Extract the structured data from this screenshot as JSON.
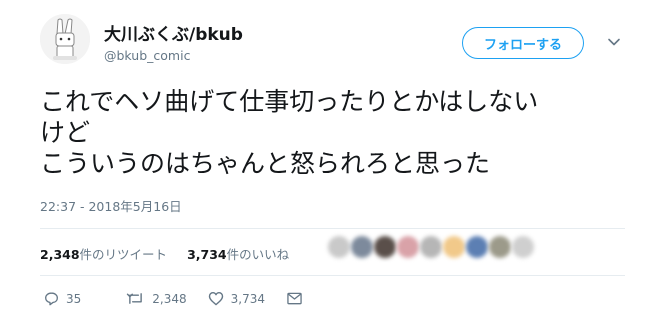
{
  "author": {
    "display_name": "大川ぶくぶ/bkub",
    "handle": "@bkub_comic"
  },
  "follow_button_label": "フォローする",
  "tweet": {
    "lines": [
      "これでヘソ曲げて仕事切ったりとかはしない",
      "けど",
      "こういうのはちゃんと怒られろと思った"
    ],
    "timestamp": "22:37 - 2018年5月16日"
  },
  "stats": {
    "retweets_count": "2,348",
    "retweets_label": "件のリツイート",
    "likes_count": "3,734",
    "likes_label": "件のいいね"
  },
  "liker_avatar_colors": [
    "#c9c9c9",
    "#7d8a9c",
    "#5a4f4a",
    "#d9a2a8",
    "#b6b6b6",
    "#f1c98a",
    "#5c7fb3",
    "#9c9a8a",
    "#cfcfcf"
  ],
  "actions": {
    "reply_count": "35",
    "retweet_count": "2,348",
    "like_count": "3,734"
  },
  "colors": {
    "accent": "#1da1f2",
    "text": "#14171a",
    "secondary": "#657786",
    "divider": "#e6ecf0"
  }
}
